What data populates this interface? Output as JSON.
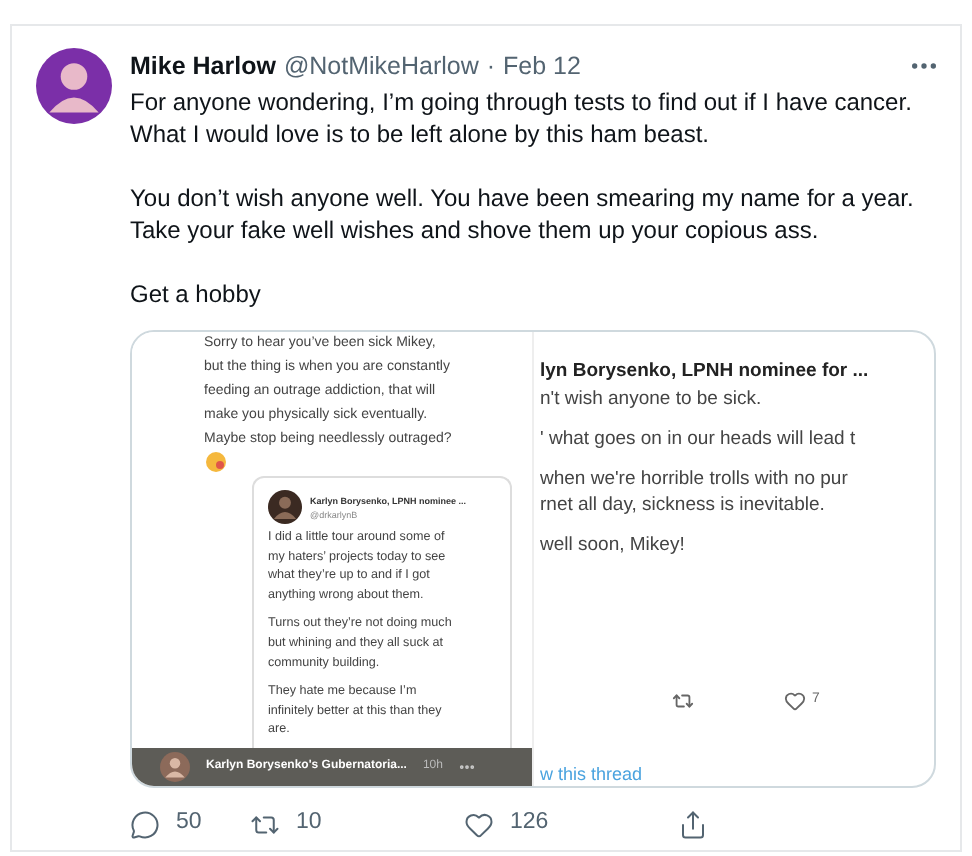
{
  "tweet": {
    "author": {
      "name": "Mike Harlow",
      "handle": "@NotMikeHarlow",
      "separator": "·",
      "date": "Feb 12"
    },
    "body": [
      [
        "For anyone wondering, I’m going through tests to find out if I have cancer.",
        "What I would love is to be left alone by this ham beast."
      ],
      [
        "You don’t wish anyone well. You have been smearing my name for a year.",
        "Take your fake well wishes and shove them up your copious ass."
      ],
      [
        "Get a hobby"
      ]
    ],
    "media": {
      "left_shot": {
        "reply": [
          "Sorry to hear you’ve been sick Mikey,",
          "but the thing is when you are constantly",
          "feeding an outrage addiction, that will",
          "make you physically sick eventually.",
          "Maybe stop being needlessly outraged?"
        ],
        "quote": {
          "author": "Karlyn Borysenko, LPNH nominee ...",
          "handle": "@drkarlynB",
          "paragraphs": [
            [
              "I did a little tour around some of",
              "my haters’ projects today to see",
              "what they’re up to and if I got",
              "anything wrong about them."
            ],
            [
              "Turns out they’re not doing much",
              "but whining and they all suck at",
              "community building."
            ],
            [
              "They hate me because I’m",
              "infinitely better at this than they",
              "are."
            ]
          ]
        },
        "footer": {
          "title": "Karlyn Borysenko's Gubernatoria...",
          "time": "10h"
        }
      },
      "right_shot": {
        "name": "lyn Borysenko, LPNH nominee for ...",
        "paragraphs": [
          [
            "n't wish anyone to be sick."
          ],
          [
            "' what goes on in our heads will lead t"
          ],
          [
            "when we're horrible trolls with no pur",
            "rnet all day, sickness is inevitable."
          ],
          [
            "well soon, Mikey!"
          ]
        ],
        "likes": "7",
        "link": "w this thread"
      }
    },
    "actions": [
      {
        "kind": "reply",
        "count": "50"
      },
      {
        "kind": "retweet",
        "count": "10"
      },
      {
        "kind": "like",
        "count": "126"
      },
      {
        "kind": "share"
      }
    ]
  }
}
